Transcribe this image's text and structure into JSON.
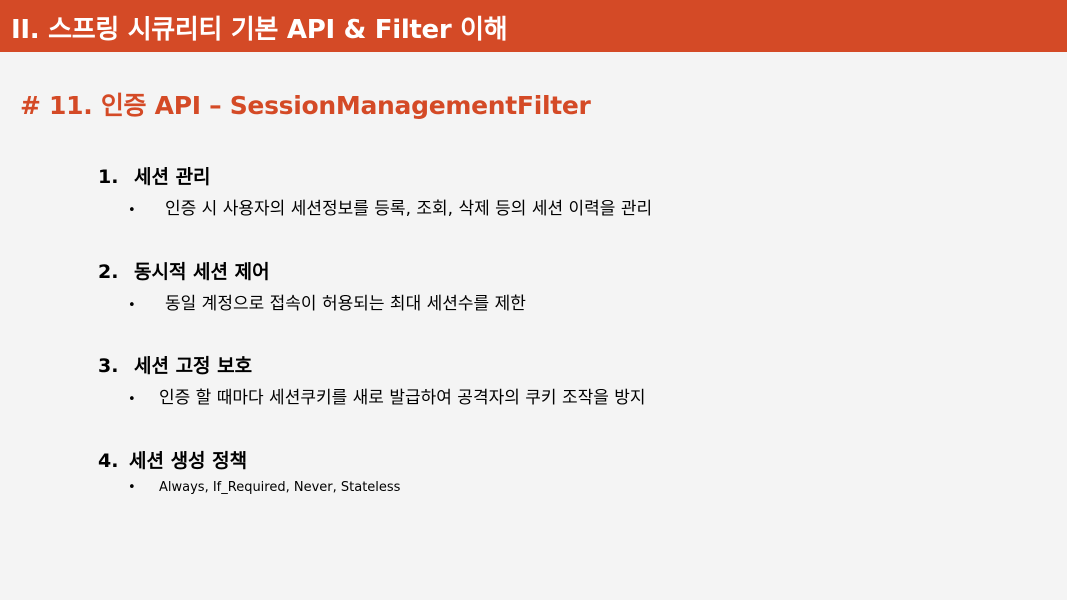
{
  "header": {
    "title": "II. 스프링 시큐리티 기본 API & Filter 이해"
  },
  "section": {
    "title": "# 11. 인증 API – SessionManagementFilter"
  },
  "items": [
    {
      "number": "1.",
      "heading": "세션 관리",
      "bullet": "•",
      "text": "인증 시 사용자의 세션정보를 등록, 조회, 삭제 등의 세션 이력을 관리"
    },
    {
      "number": "2.",
      "heading": "동시적 세션 제어",
      "bullet": "•",
      "text": "동일 계정으로 접속이 허용되는 최대 세션수를 제한"
    },
    {
      "number": "3.",
      "heading": "세션 고정 보호",
      "bullet": "•",
      "text": "인증 할 때마다 세션쿠키를 새로 발급하여 공격자의 쿠키 조작을 방지"
    },
    {
      "number": "4.",
      "heading": "세션 생성 정책",
      "bullet": "•",
      "text": "Always, If_Required, Never, Stateless"
    }
  ],
  "colors": {
    "accent": "#d44a26",
    "background": "#f4f4f4"
  }
}
